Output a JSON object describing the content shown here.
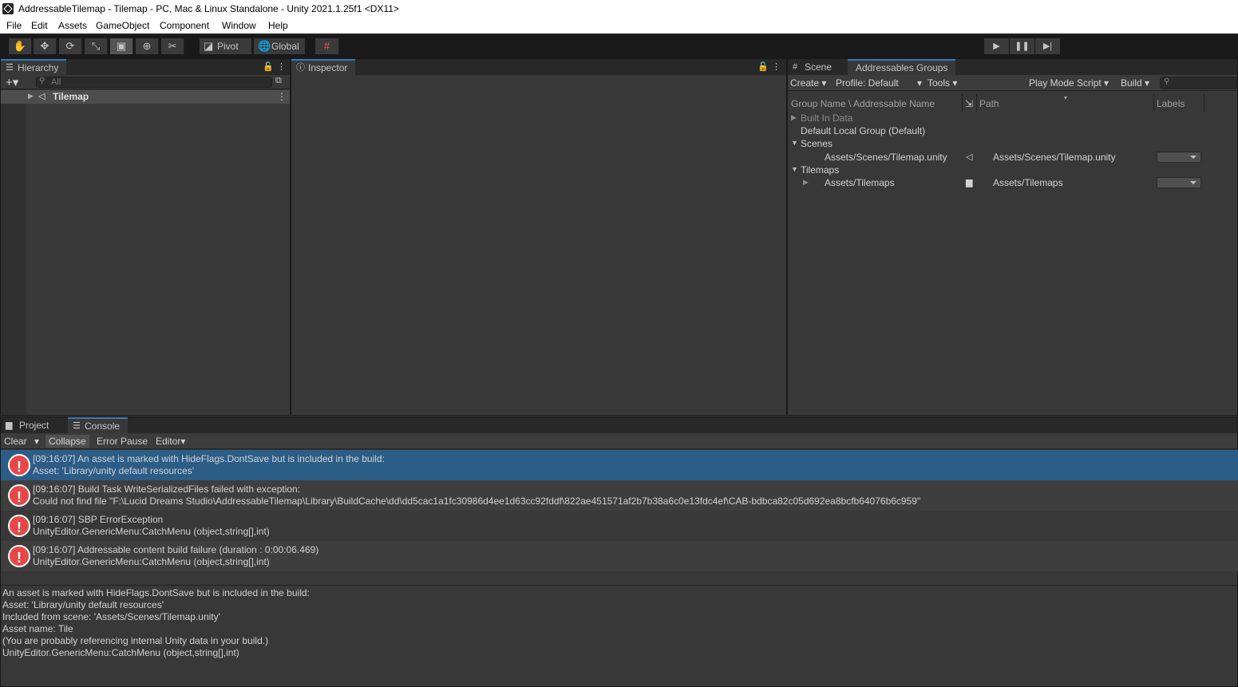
{
  "window": {
    "title": "AddressableTilemap - Tilemap - PC, Mac & Linux Standalone - Unity 2021.1.25f1 <DX11>"
  },
  "menu": [
    "File",
    "Edit",
    "Assets",
    "GameObject",
    "Component",
    "Window",
    "Help"
  ],
  "toolbar": {
    "tools": [
      "hand-tool-icon",
      "move-tool-icon",
      "rotate-tool-icon",
      "scale-tool-icon",
      "rect-tool-icon",
      "transform-tool-icon",
      "custom-tool-icon"
    ],
    "pivot": "Pivot",
    "global": "Global"
  },
  "hierarchy": {
    "tab": "Hierarchy",
    "search_placeholder": "All",
    "root_item": "Tilemap"
  },
  "inspector": {
    "tab": "Inspector"
  },
  "right_panel": {
    "tabs": [
      "Scene",
      "Addressables Groups"
    ],
    "toolbar": {
      "create": "Create",
      "profile": "Profile: Default",
      "tools": "Tools",
      "play_mode": "Play Mode Script",
      "build": "Build"
    },
    "columns": {
      "name": "Group Name \\ Addressable Name",
      "path": "Path",
      "labels": "Labels"
    },
    "groups": [
      {
        "name": "Built In Data"
      },
      {
        "name": "Default Local Group (Default)"
      },
      {
        "name": "Scenes",
        "entry": {
          "name": "Assets/Scenes/Tilemap.unity",
          "path": "Assets/Scenes/Tilemap.unity"
        }
      },
      {
        "name": "Tilemaps",
        "entry": {
          "name": "Assets/Tilemaps",
          "path": "Assets/Tilemaps"
        }
      }
    ]
  },
  "bottom": {
    "tabs": [
      "Project",
      "Console"
    ],
    "toolbar": {
      "clear": "Clear",
      "collapse": "Collapse",
      "error_pause": "Error Pause",
      "editor": "Editor"
    },
    "logs": [
      {
        "line1": "[09:16:07] An asset is marked with HideFlags.DontSave but is included in the build:",
        "line2": "Asset: 'Library/unity default resources'"
      },
      {
        "line1": "[09:16:07] Build Task WriteSerializedFiles failed with exception:",
        "line2": "Could not find file \"F:\\Lucid Dreams Studio\\AddressableTilemap\\Library\\BuildCache\\dd\\dd5cac1a1fc30986d4ee1d63cc92fddf\\822ae451571af2b7b38a6c0e13fdc4ef\\CAB-bdbca82c05d692ea8bcfb64076b6c959\""
      },
      {
        "line1": "[09:16:07] SBP ErrorException",
        "line2": "UnityEditor.GenericMenu:CatchMenu (object,string[],int)"
      },
      {
        "line1": "[09:16:07] Addressable content build failure (duration : 0:00:06.469)",
        "line2": "UnityEditor.GenericMenu:CatchMenu (object,string[],int)"
      }
    ],
    "detail": [
      "An asset is marked with HideFlags.DontSave but is included in the build:",
      "Asset: 'Library/unity default resources'",
      "Included from scene: 'Assets/Scenes/Tilemap.unity'",
      "Asset name: Tile",
      "(You are probably referencing internal Unity data in your build.)",
      "UnityEditor.GenericMenu:CatchMenu (object,string[],int)"
    ]
  },
  "colors": {
    "selected_row": "#2c5d87",
    "error_icon": "#e84747",
    "active_tab": "#3a79bb"
  }
}
